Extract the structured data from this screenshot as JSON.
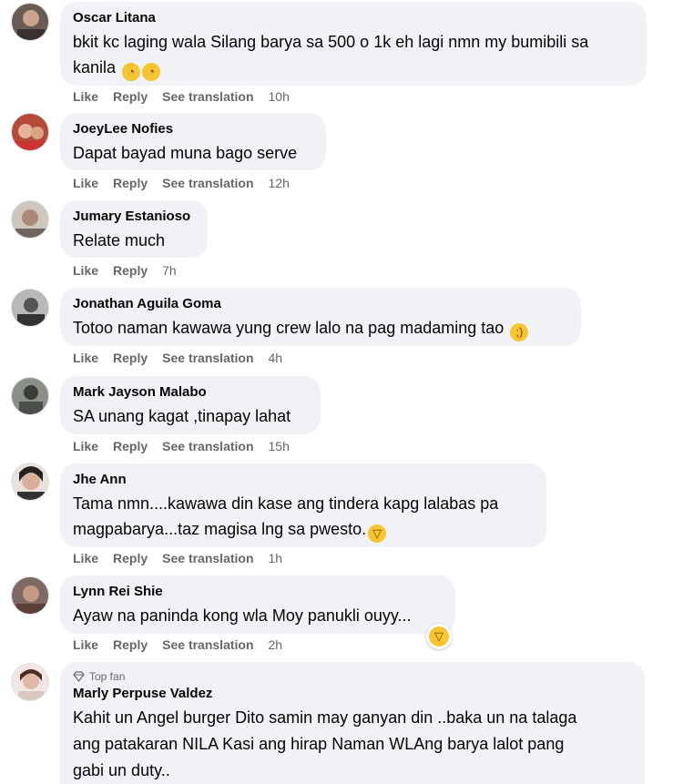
{
  "comments": [
    {
      "name": "Oscar Litana",
      "line1": "bkit kc laging wala Silang barya sa 500 o 1k eh lagi nmn my bumibili sa",
      "line2": "kanila",
      "time": "10h"
    },
    {
      "name": "JoeyLee Nofies",
      "line1": "Dapat bayad muna bago serve",
      "time": "12h"
    },
    {
      "name": "Jumary Estanioso",
      "line1": "Relate much",
      "time": "7h"
    },
    {
      "name": "Jonathan Aguila Goma",
      "line1": "Totoo naman kawawa yung crew lalo na pag madaming tao",
      "time": "4h"
    },
    {
      "name": "Mark Jayson Malabo",
      "line1": "SA unang kagat ,tinapay lahat",
      "time": "15h"
    },
    {
      "name": "Jhe Ann",
      "line1": "Tama nmn....kawawa din kase ang tindera kapg lalabas pa",
      "line2": "magpabarya...taz magisa lng sa pwesto.",
      "time": "1h"
    },
    {
      "name": "Lynn Rei Shie",
      "line1": "Ayaw na paninda kong wla Moy panukli ouyy...",
      "time": "2h"
    },
    {
      "name": "Marly Perpuse Valdez",
      "badge": "Top fan",
      "line1": "Kahit un Angel burger Dito samin may ganyan din ..baka un na talaga",
      "line2": "ang patakaran NILA Kasi ang hirap Naman WLAng barya lalot pang",
      "line3": "gabi un duty.."
    }
  ],
  "actions": {
    "like": "Like",
    "reply": "Reply",
    "translate": "See translation"
  },
  "icons": {
    "emoji_face": "face-with-rolling-eyes",
    "emoji_wink": "winking-face",
    "emoji_laugh": "laughing-face",
    "badge": "diamond-icon"
  },
  "colors": {
    "bubble": "#f0f2f5",
    "meta": "#65676b",
    "text": "#050505",
    "emoji": "#f7c531"
  }
}
